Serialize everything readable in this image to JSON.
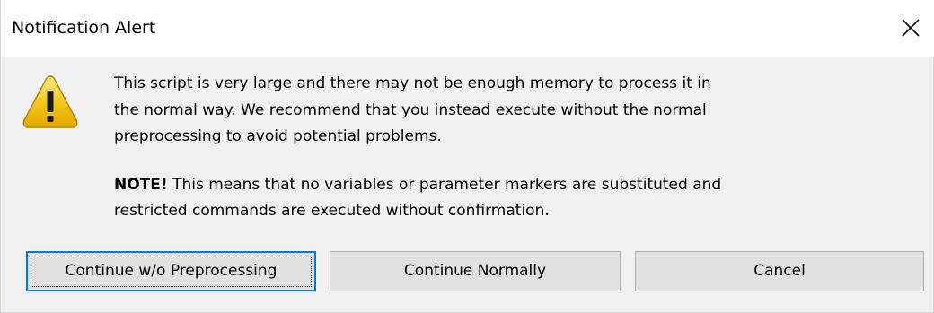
{
  "window": {
    "title": "Notification Alert",
    "close_icon": "close-icon"
  },
  "icon": {
    "name": "warning-icon",
    "color": "#f5c518"
  },
  "message": {
    "line1": "This script is very large and there may not be enough memory to process it in",
    "line2": "the normal way. We recommend that you instead execute without the normal",
    "line3": "preprocessing to avoid potential problems.",
    "note_label": "NOTE!",
    "note_line1": " This means that no variables or parameter markers are substituted and",
    "note_line2": "restricted commands are executed without confirmation."
  },
  "buttons": {
    "continue_wo_preprocessing": "Continue w/o Preprocessing",
    "continue_normally": "Continue Normally",
    "cancel": "Cancel"
  },
  "colors": {
    "accent": "#0078d7",
    "dialog_bg": "#f0f0f0",
    "button_bg": "#e1e1e1"
  }
}
